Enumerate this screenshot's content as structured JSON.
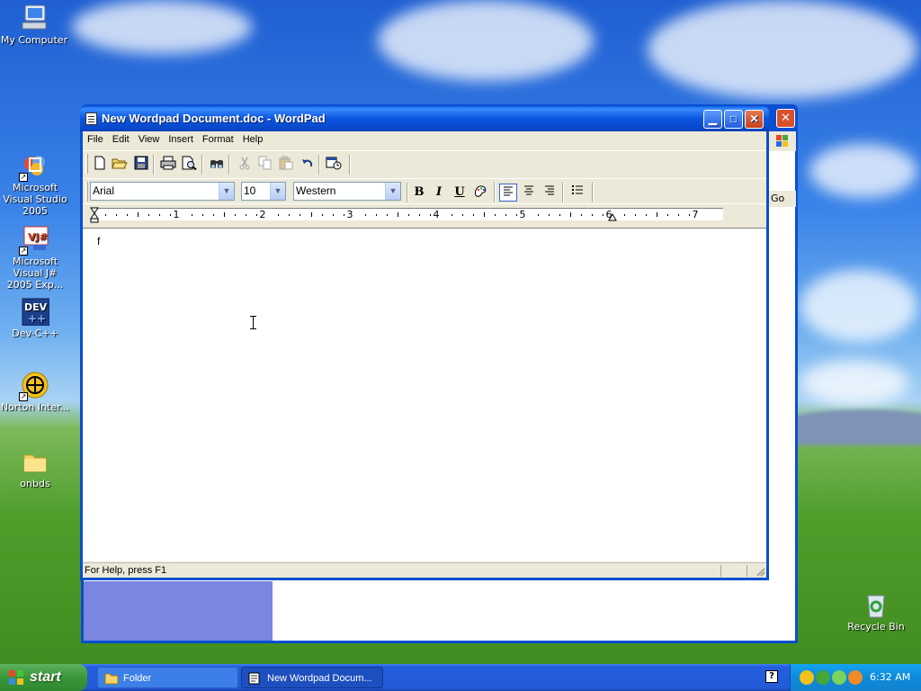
{
  "desktop": {
    "icons": [
      {
        "label": "My Computer",
        "icon": "computer-icon"
      },
      {
        "label": "Microsoft Visual Studio 2005",
        "icon": "visual-studio-icon"
      },
      {
        "label": "Microsoft Visual J# 2005 Exp...",
        "icon": "visual-jsharp-icon"
      },
      {
        "label": "Dev-C++",
        "icon": "devcpp-icon"
      },
      {
        "label": "Norton Inter...",
        "icon": "norton-icon"
      },
      {
        "label": "onbds",
        "icon": "folder-icon"
      },
      {
        "label": "Recycle Bin",
        "icon": "recycle-bin-icon"
      }
    ]
  },
  "background_window": {
    "go_label": "Go"
  },
  "wordpad": {
    "title": "New Wordpad Document.doc - WordPad",
    "menu": [
      "File",
      "Edit",
      "View",
      "Insert",
      "Format",
      "Help"
    ],
    "toolbar": [
      "new-icon",
      "open-icon",
      "save-icon",
      "print-icon",
      "print-preview-icon",
      "find-icon",
      "cut-icon",
      "copy-icon",
      "paste-icon",
      "undo-icon",
      "insert-datetime-icon"
    ],
    "format": {
      "font": "Arial",
      "size": "10",
      "script": "Western",
      "bold": "B",
      "italic": "I",
      "underline": "U"
    },
    "ruler": {
      "numbers": [
        "1",
        "2",
        "3",
        "4",
        "5",
        "6",
        "7"
      ]
    },
    "document_text": "f",
    "status": "For Help, press F1"
  },
  "taskbar": {
    "start_label": "start",
    "buttons": [
      {
        "label": "Folder",
        "icon": "folder-icon"
      },
      {
        "label": "New Wordpad Docum...",
        "icon": "wordpad-icon"
      }
    ],
    "clock": "6:32 AM"
  }
}
